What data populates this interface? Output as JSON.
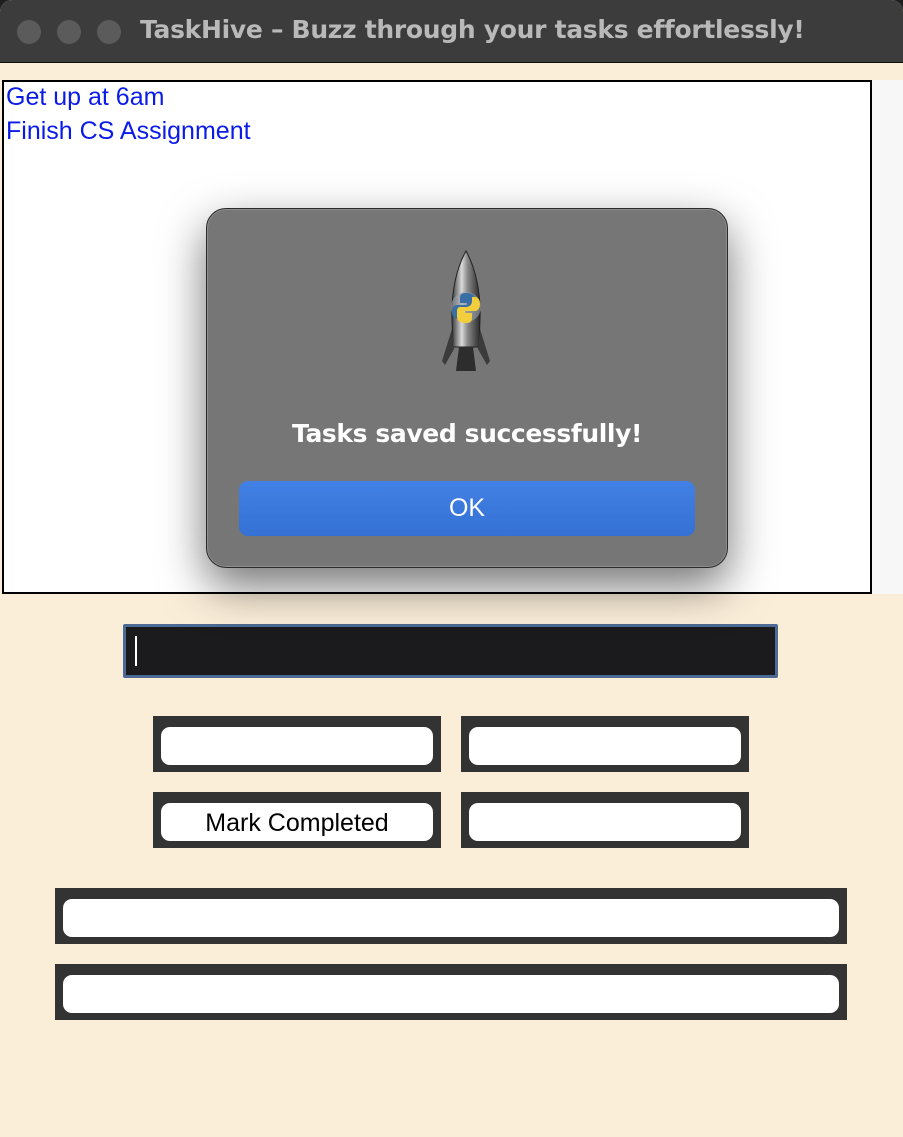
{
  "window": {
    "title": "TaskHive – Buzz through your tasks effortlessly!"
  },
  "tasks": [
    "Get up at 6am",
    "Finish CS Assignment"
  ],
  "task_entry": {
    "value": ""
  },
  "buttons": {
    "top_left": "",
    "top_right": "",
    "mark_completed": "Mark Completed",
    "bottom_right": "",
    "wide_1": "",
    "wide_2": ""
  },
  "dialog": {
    "icon": "python-launcher-rocket-icon",
    "message": "Tasks saved successfully!",
    "ok_label": "OK"
  },
  "colors": {
    "background": "#fbeed9",
    "task_text": "#0a1be8",
    "dialog_button": "#3a78dd"
  }
}
